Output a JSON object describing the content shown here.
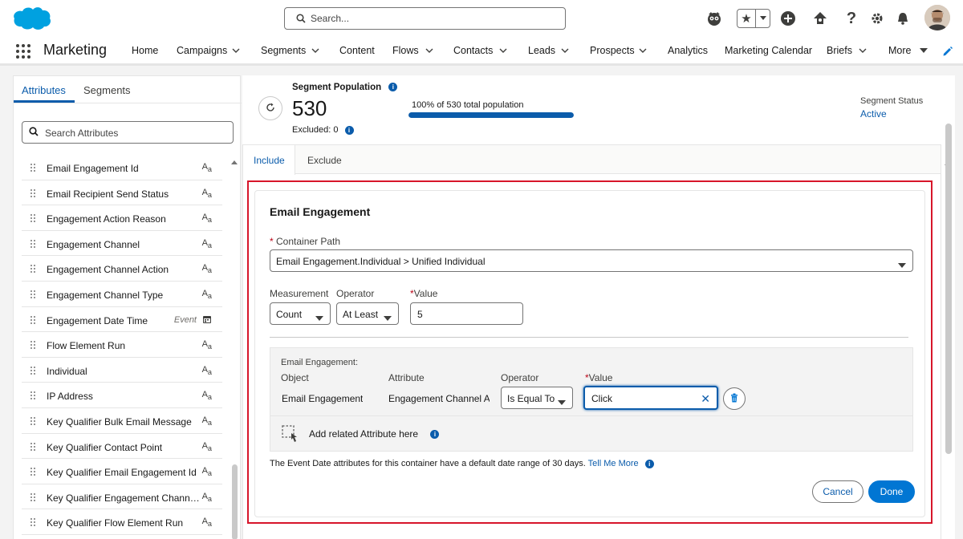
{
  "header": {
    "search_placeholder": "Search...",
    "icons": [
      "salesforce-logo",
      "einstein-icon",
      "favorites-star-icon",
      "add-icon",
      "trailhead-icon",
      "help-icon",
      "setup-gear-icon",
      "notifications-bell-icon",
      "user-avatar"
    ]
  },
  "nav": {
    "app_name": "Marketing",
    "items": [
      {
        "label": "Home",
        "has_menu": false
      },
      {
        "label": "Campaigns",
        "has_menu": true
      },
      {
        "label": "Segments",
        "has_menu": true
      },
      {
        "label": "Content",
        "has_menu": false
      },
      {
        "label": "Flows",
        "has_menu": true
      },
      {
        "label": "Contacts",
        "has_menu": true
      },
      {
        "label": "Leads",
        "has_menu": true
      },
      {
        "label": "Prospects",
        "has_menu": true
      },
      {
        "label": "Analytics",
        "has_menu": false
      },
      {
        "label": "Marketing Calendar",
        "has_menu": false
      },
      {
        "label": "Briefs",
        "has_menu": true
      },
      {
        "label": "More",
        "has_menu": true
      }
    ]
  },
  "left_panel": {
    "tabs": [
      "Attributes",
      "Segments"
    ],
    "active_tab": "Attributes",
    "search_placeholder": "Search Attributes",
    "attributes": [
      {
        "label": "Email Engagement Id",
        "type_icon": "text-type-icon",
        "tag": ""
      },
      {
        "label": "Email Recipient Send Status",
        "type_icon": "text-type-icon",
        "tag": ""
      },
      {
        "label": "Engagement Action Reason",
        "type_icon": "text-type-icon",
        "tag": ""
      },
      {
        "label": "Engagement Channel",
        "type_icon": "text-type-icon",
        "tag": ""
      },
      {
        "label": "Engagement Channel Action",
        "type_icon": "text-type-icon",
        "tag": ""
      },
      {
        "label": "Engagement Channel Type",
        "type_icon": "text-type-icon",
        "tag": ""
      },
      {
        "label": "Engagement Date Time",
        "type_icon": "date-type-icon",
        "tag": "Event"
      },
      {
        "label": "Flow Element Run",
        "type_icon": "text-type-icon",
        "tag": ""
      },
      {
        "label": "Individual",
        "type_icon": "text-type-icon",
        "tag": ""
      },
      {
        "label": "IP Address",
        "type_icon": "text-type-icon",
        "tag": ""
      },
      {
        "label": "Key Qualifier Bulk Email Message",
        "type_icon": "text-type-icon",
        "tag": ""
      },
      {
        "label": "Key Qualifier Contact Point",
        "type_icon": "text-type-icon",
        "tag": ""
      },
      {
        "label": "Key Qualifier Email Engagement Id",
        "type_icon": "text-type-icon",
        "tag": ""
      },
      {
        "label": "Key Qualifier Engagement Channel T...",
        "type_icon": "text-type-icon",
        "tag": ""
      },
      {
        "label": "Key Qualifier Flow Element Run",
        "type_icon": "text-type-icon",
        "tag": ""
      }
    ]
  },
  "segment": {
    "population_label": "Segment Population",
    "population_value": "530",
    "excluded_text": "Excluded: 0",
    "bar_label": "100% of 530 total population",
    "bar_fraction": 1.0,
    "status_label": "Segment Status",
    "status_value": "Active"
  },
  "tabs": [
    "Include",
    "Exclude"
  ],
  "container": {
    "title": "Email Engagement",
    "container_path_label": "Container Path",
    "container_path_value": "Email Engagement.Individual > Unified Individual",
    "measurement_label": "Measurement",
    "measurement_value": "Count",
    "operator_label": "Operator",
    "operator_value": "At Least",
    "value_label": "Value",
    "value_value": "5",
    "sub": {
      "heading": "Email Engagement:",
      "object_label": "Object",
      "attribute_label": "Attribute",
      "operator_label": "Operator",
      "value_label": "Value",
      "object_value": "Email Engagement",
      "attribute_value": "Engagement Channel Act",
      "operator_value": "Is Equal To",
      "value_value": "Click",
      "add_related_text": "Add related Attribute here"
    },
    "footnote": "The Event Date attributes for this container have a default date range of 30 days.",
    "footnote_link": "Tell Me More",
    "cancel_label": "Cancel",
    "done_label": "Done"
  },
  "colors": {
    "brand_blue": "#0b5cab",
    "button_blue": "#0176d3",
    "highlight_red": "#d7152a",
    "salesforce_cloud": "#00a1e0"
  }
}
